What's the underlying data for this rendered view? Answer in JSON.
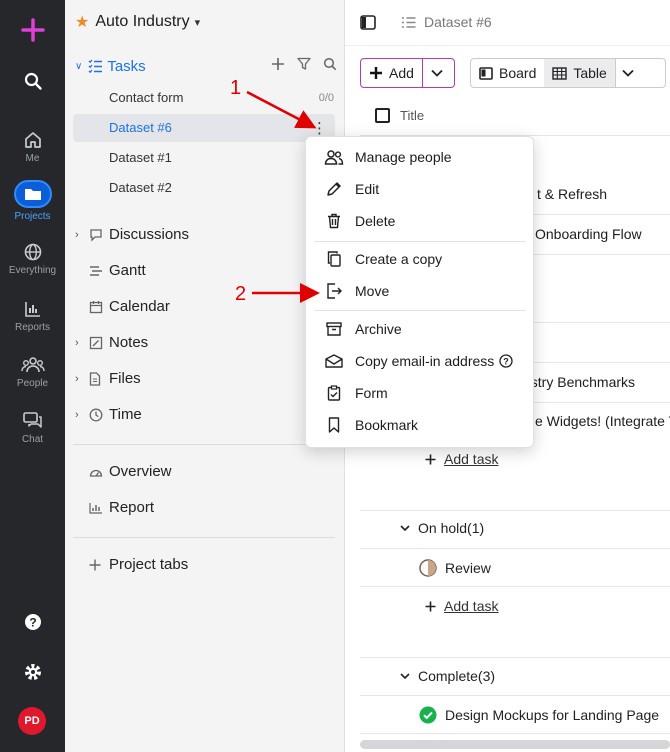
{
  "rail": {
    "logo": "plus-logo",
    "items": [
      {
        "label": "",
        "icon": "search-icon"
      },
      {
        "label": "Me",
        "icon": "home-icon"
      },
      {
        "label": "Projects",
        "icon": "folder-icon"
      },
      {
        "label": "Everything",
        "icon": "globe-icon"
      },
      {
        "label": "Reports",
        "icon": "bar-chart-icon"
      },
      {
        "label": "People",
        "icon": "people-icon"
      },
      {
        "label": "Chat",
        "icon": "chat-icon"
      }
    ],
    "avatar": "PD"
  },
  "sidebar": {
    "workspace": "Auto Industry",
    "tasks": {
      "label": "Tasks",
      "children": [
        {
          "label": "Contact form",
          "count": "0/0"
        },
        {
          "label": "Dataset #6"
        },
        {
          "label": "Dataset #1"
        },
        {
          "label": "Dataset #2"
        }
      ]
    },
    "nav": [
      "Discussions",
      "Gantt",
      "Calendar",
      "Notes",
      "Files",
      "Time"
    ],
    "extra": [
      "Overview",
      "Report"
    ],
    "project_tabs": "Project tabs"
  },
  "main": {
    "breadcrumb": "Dataset #6",
    "add_label": "Add",
    "views": {
      "board": "Board",
      "table": "Table"
    },
    "title_col": "Title",
    "rows": [
      "t & Refresh",
      "Onboarding Flow",
      "ustry Benchmarks",
      "e Widgets! (Integrate T"
    ],
    "add_task": "Add task",
    "groups": [
      {
        "label": "On hold(1)",
        "task": "Review"
      },
      {
        "label": "Complete(3)",
        "task": "Design Mockups for Landing Page"
      }
    ]
  },
  "menu": {
    "items": [
      {
        "label": "Manage people",
        "icon": "people-icon"
      },
      {
        "label": "Edit",
        "icon": "pencil-icon"
      },
      {
        "label": "Delete",
        "icon": "trash-icon"
      },
      {
        "label": "Create a copy",
        "icon": "copy-icon"
      },
      {
        "label": "Move",
        "icon": "move-icon"
      },
      {
        "label": "Archive",
        "icon": "archive-icon"
      },
      {
        "label": "Copy email-in address",
        "icon": "mail-icon"
      },
      {
        "label": "Form",
        "icon": "clipboard-icon"
      },
      {
        "label": "Bookmark",
        "icon": "bookmark-icon"
      }
    ]
  },
  "annotations": {
    "one": "1",
    "two": "2"
  },
  "colors": {
    "accent": "#1a73e8",
    "brand": "#b03ab8",
    "annotation": "#e00000",
    "rail": "#25272b"
  }
}
